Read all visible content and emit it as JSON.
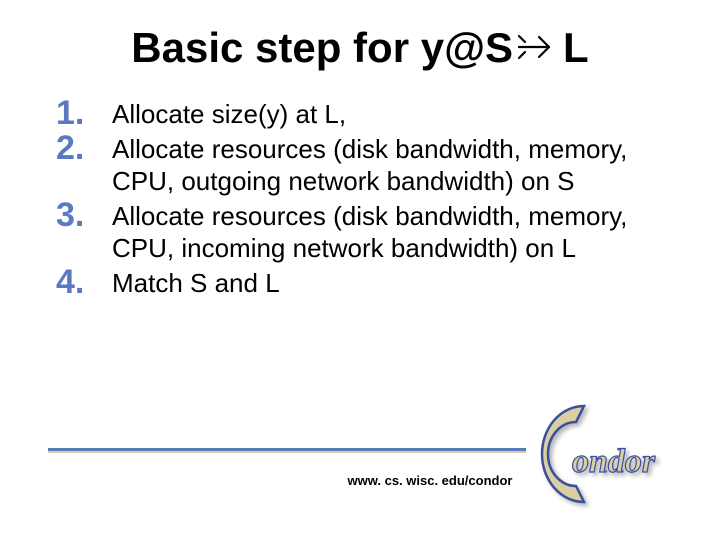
{
  "title_prefix": "Basic step for y@S",
  "title_suffix": "L",
  "steps": [
    "Allocate size(y) at L,",
    "Allocate resources (disk bandwidth, memory, CPU, outgoing network bandwidth) on S",
    "Allocate resources (disk bandwidth, memory, CPU, incoming network bandwidth) on L",
    "Match S and L"
  ],
  "footer_url": "www. cs. wisc. edu/condor",
  "logo_text": "ondor",
  "colors": {
    "accent": "#5a7ac0",
    "logo_fill": "#d9cfa3",
    "logo_stroke": "#3a4fa0"
  }
}
